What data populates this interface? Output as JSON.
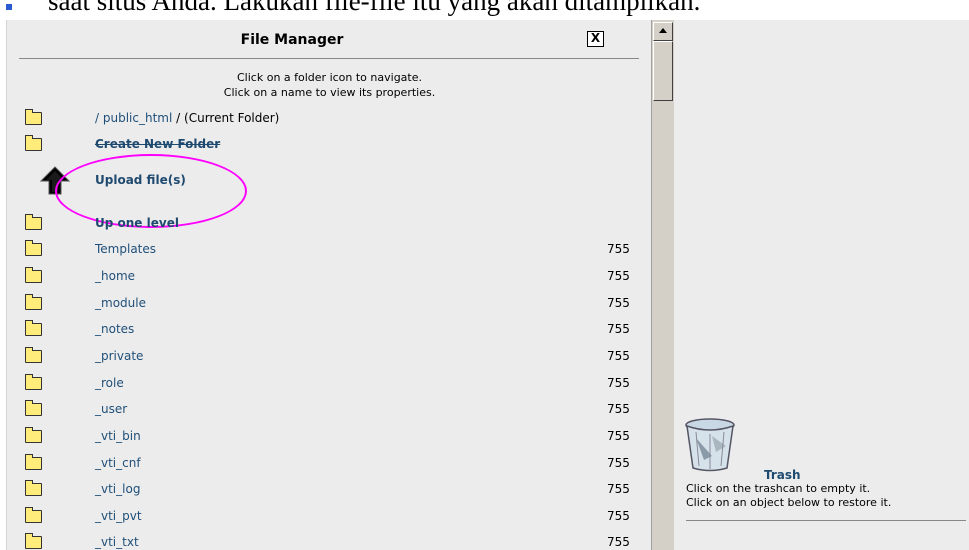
{
  "document": {
    "caption": "saat situs Anda. Lakukan file-file itu yang akan ditampilkan."
  },
  "file_manager": {
    "title": "File Manager",
    "close_label": "X",
    "instructions": {
      "line1": "Click on a folder icon to navigate.",
      "line2": "Click on a name to view its properties."
    },
    "current_folder": {
      "sep1": "/",
      "folder": "public_html",
      "sep2": "/",
      "suffix": "(Current Folder)"
    },
    "actions": {
      "create_folder": "Create New Folder",
      "upload": "Upload file(s)",
      "up_level": "Up one level"
    },
    "folders": [
      {
        "name": "Templates",
        "perm": "755"
      },
      {
        "name": "_home",
        "perm": "755"
      },
      {
        "name": "_module",
        "perm": "755"
      },
      {
        "name": "_notes",
        "perm": "755"
      },
      {
        "name": "_private",
        "perm": "755"
      },
      {
        "name": "_role",
        "perm": "755"
      },
      {
        "name": "_user",
        "perm": "755"
      },
      {
        "name": "_vti_bin",
        "perm": "755"
      },
      {
        "name": "_vti_cnf",
        "perm": "755"
      },
      {
        "name": "_vti_log",
        "perm": "755"
      },
      {
        "name": "_vti_pvt",
        "perm": "755"
      },
      {
        "name": "_vti_txt",
        "perm": "755"
      }
    ]
  },
  "trash": {
    "label": "Trash",
    "line1": "Click on the trashcan to empty it.",
    "line2": "Click on an object below to restore it."
  },
  "colors": {
    "link": "#1f4f79",
    "highlight": "#ff00ff",
    "pane_bg": "#ececec"
  }
}
